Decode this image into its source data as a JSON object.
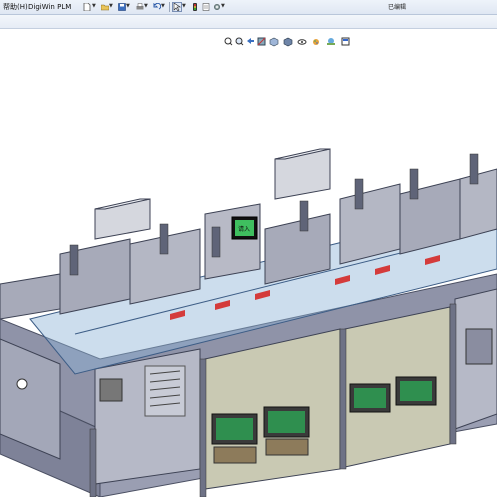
{
  "app": {
    "menu": {
      "help": "帮助(H)",
      "plm": "DigiWin PLM"
    },
    "right_status": "已编辑",
    "toolbar_icons": [
      "new-document-icon",
      "open-folder-icon",
      "save-icon",
      "print-icon",
      "undo-icon",
      "select-arrow-icon",
      "rebuild-traffic-light-icon",
      "file-properties-icon",
      "options-gear-icon"
    ],
    "heads_up_icons": [
      "zoom-to-fit-icon",
      "zoom-area-icon",
      "previous-view-icon",
      "section-view-icon",
      "view-orientation-icon",
      "display-style-icon",
      "hide-show-icon",
      "edit-appearance-icon",
      "scene-icon",
      "view-settings-icon"
    ]
  },
  "model": {
    "panel_screen_label": "请入",
    "colors": {
      "frame": "#8f93a8",
      "frame_dark": "#5f6478",
      "panel": "#c9c9b3",
      "cover_blue": "#8fb4d6",
      "accent_red": "#d43b3b",
      "pcb_green": "#2f8f4f",
      "module_gray": "#a7aab9"
    }
  }
}
